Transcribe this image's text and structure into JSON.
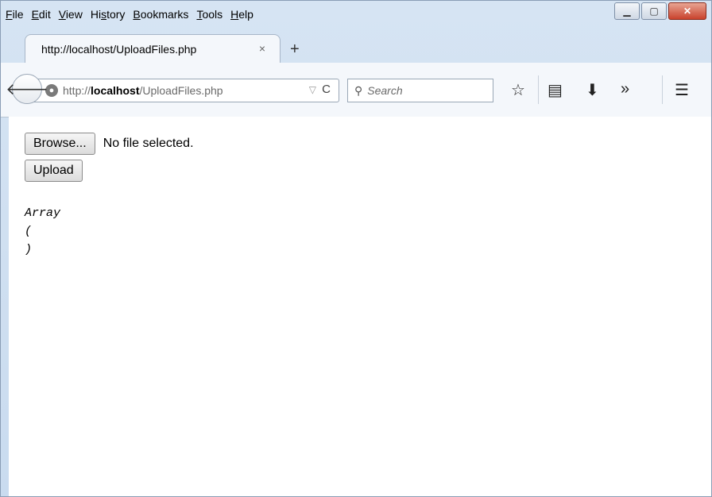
{
  "menu": [
    {
      "pre": "",
      "u": "F",
      "post": "ile"
    },
    {
      "pre": "",
      "u": "E",
      "post": "dit"
    },
    {
      "pre": "",
      "u": "V",
      "post": "iew"
    },
    {
      "pre": "Hi",
      "u": "s",
      "post": "tory"
    },
    {
      "pre": "",
      "u": "B",
      "post": "ookmarks"
    },
    {
      "pre": "",
      "u": "T",
      "post": "ools"
    },
    {
      "pre": "",
      "u": "H",
      "post": "elp"
    }
  ],
  "tab": {
    "title": "http://localhost/UploadFiles.php",
    "close": "×"
  },
  "new_tab": "+",
  "address": {
    "scheme": "http://",
    "host": "localhost",
    "path": "/UploadFiles.php"
  },
  "search": {
    "placeholder": "Search"
  },
  "page": {
    "browse_label": "Browse...",
    "file_status": "No file selected.",
    "upload_label": "Upload",
    "output": "Array\n(\n)"
  }
}
